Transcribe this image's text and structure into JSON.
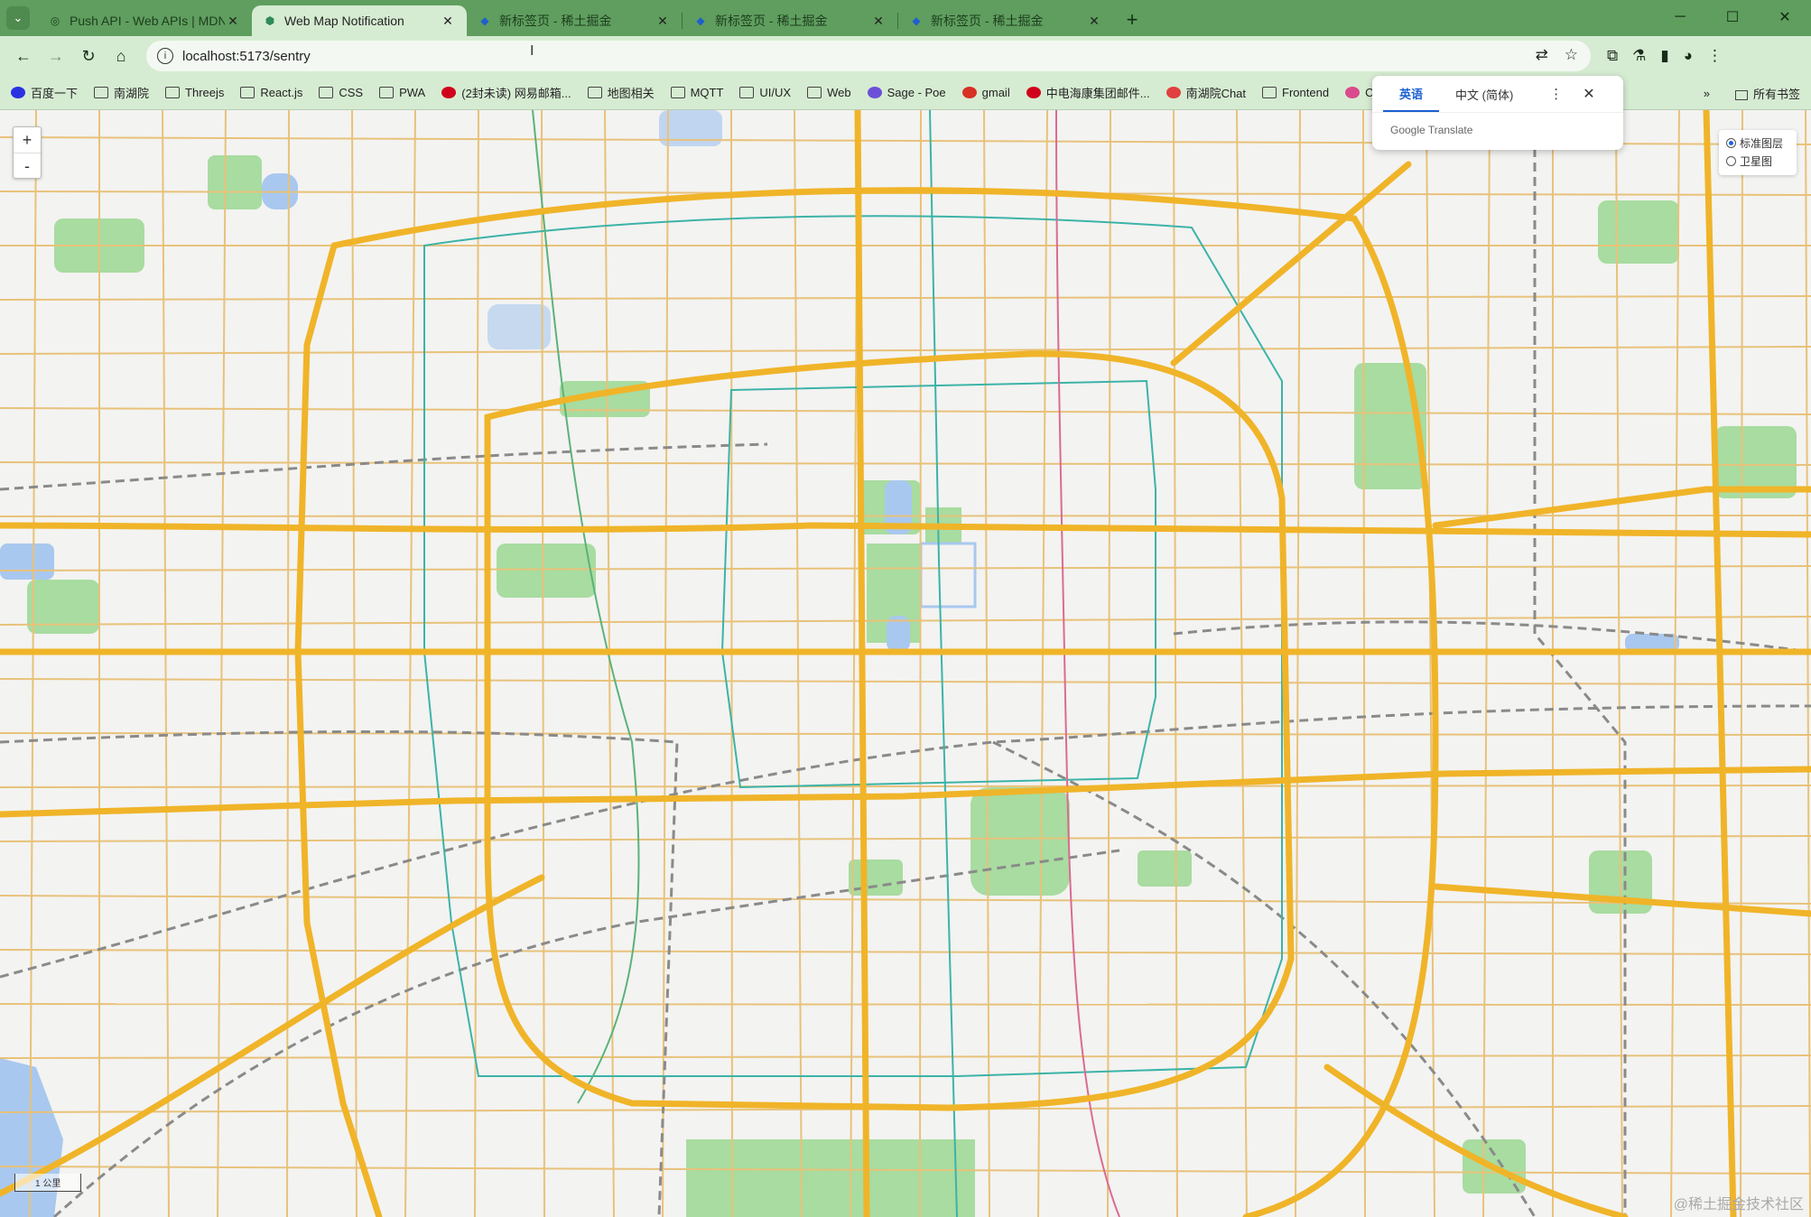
{
  "tabs": [
    {
      "title": "Push API - Web APIs | MDN",
      "favicon": "mdn-icon",
      "active": false
    },
    {
      "title": "Web Map Notification",
      "favicon": "vite-icon",
      "active": true
    },
    {
      "title": "新标签页 - 稀土掘金",
      "favicon": "juejin-icon",
      "active": false
    },
    {
      "title": "新标签页 - 稀土掘金",
      "favicon": "juejin-icon",
      "active": false
    },
    {
      "title": "新标签页 - 稀土掘金",
      "favicon": "juejin-icon",
      "active": false
    }
  ],
  "tab_close_glyph": "✕",
  "new_tab_glyph": "+",
  "address": {
    "url": "localhost:5173/sentry"
  },
  "bookmarks": [
    {
      "label": "百度一下",
      "icon": "baidu-icon",
      "color": "#2932e1"
    },
    {
      "label": "南湖院",
      "icon": "folder-icon"
    },
    {
      "label": "Threejs",
      "icon": "folder-icon"
    },
    {
      "label": "React.js",
      "icon": "folder-icon"
    },
    {
      "label": "CSS",
      "icon": "folder-icon"
    },
    {
      "label": "PWA",
      "icon": "folder-icon"
    },
    {
      "label": "(2封未读) 网易邮箱...",
      "icon": "netease-mail-icon",
      "color": "#d0021b"
    },
    {
      "label": "地图相关",
      "icon": "folder-icon"
    },
    {
      "label": "MQTT",
      "icon": "folder-icon"
    },
    {
      "label": "UI/UX",
      "icon": "folder-icon"
    },
    {
      "label": "Web",
      "icon": "folder-icon"
    },
    {
      "label": "Sage - Poe",
      "icon": "poe-icon",
      "color": "#6b4fd8"
    },
    {
      "label": "gmail",
      "icon": "gmail-icon",
      "color": "#d93025"
    },
    {
      "label": "中电海康集团邮件...",
      "icon": "cetc-icon",
      "color": "#d0021b"
    },
    {
      "label": "南湖院Chat",
      "icon": "chat-icon",
      "color": "#e04040"
    },
    {
      "label": "Frontend",
      "icon": "folder-icon"
    },
    {
      "label": "Chat",
      "icon": "chat-icon",
      "color": "#d94b8c"
    }
  ],
  "bookmarks_more": "»",
  "all_bookmarks": "所有书签",
  "translate": {
    "source_lang": "英语",
    "target_lang": "中文 (简体)",
    "brand": "Google Translate"
  },
  "map": {
    "zoom_in": "+",
    "zoom_out": "-",
    "layers": [
      {
        "label": "标准图层",
        "selected": true
      },
      {
        "label": "卫星图",
        "selected": false
      }
    ],
    "scale_label": "1 公里",
    "watermark": "@稀土掘金技术社区",
    "colors": {
      "major_road": "#f0b429",
      "minor_road": "#e8c27a",
      "park": "#a8dca0",
      "water": "#a9c8ef",
      "rail": "#8a8a8a",
      "metro_teal": "#3cb3a8",
      "metro_pink": "#d96b93"
    }
  }
}
